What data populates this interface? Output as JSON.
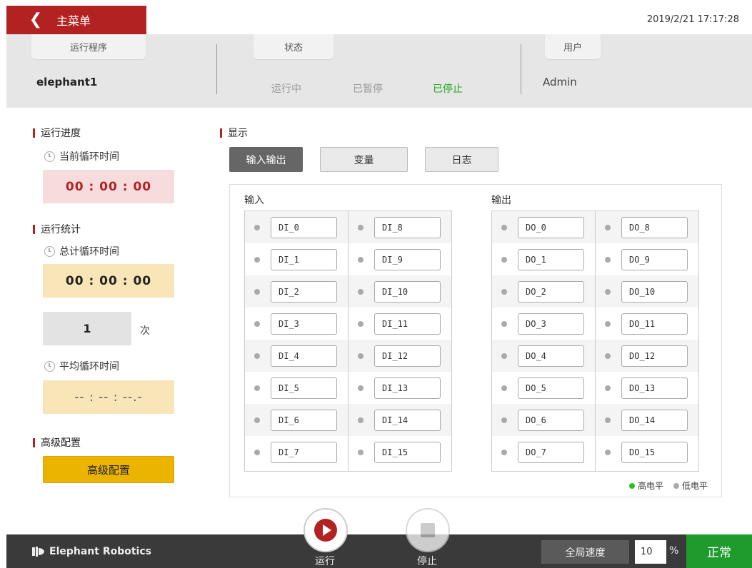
{
  "header_bar": {
    "back_label": "主菜单",
    "datetime": "2019/2/21 17:17:28"
  },
  "status_header": {
    "program_tab": "运行程序",
    "program_name": "elephant1",
    "state_tab": "状态",
    "states": [
      {
        "label": "运行中",
        "active": false
      },
      {
        "label": "已暂停",
        "active": false
      },
      {
        "label": "已停止",
        "active": true
      }
    ],
    "user_tab": "用户",
    "user_name": "Admin"
  },
  "left_panel": {
    "progress_title": "运行进度",
    "current_cycle_label": "当前循环时间",
    "current_cycle_time": "00 : 00 : 00",
    "stats_title": "运行统计",
    "total_cycle_label": "总计循环时间",
    "total_cycle_time": "00 : 00 : 00",
    "cycle_count": "1",
    "cycle_count_unit": "次",
    "avg_cycle_label": "平均循环时间",
    "avg_cycle_time": "-- : -- : --.-",
    "advanced_title": "高级配置",
    "advanced_button": "高级配置"
  },
  "display": {
    "title": "显示",
    "tabs": [
      {
        "label": "输入输出",
        "active": true
      },
      {
        "label": "变量",
        "active": false
      },
      {
        "label": "日志",
        "active": false
      }
    ],
    "input_title": "输入",
    "output_title": "输出",
    "inputs_left": [
      "DI_0",
      "DI_1",
      "DI_2",
      "DI_3",
      "DI_4",
      "DI_5",
      "DI_6",
      "DI_7"
    ],
    "inputs_right": [
      "DI_8",
      "DI_9",
      "DI_10",
      "DI_11",
      "DI_12",
      "DI_13",
      "DI_14",
      "DI_15"
    ],
    "outputs_left": [
      "DO_0",
      "DO_1",
      "DO_2",
      "DO_3",
      "DO_4",
      "DO_5",
      "DO_6",
      "DO_7"
    ],
    "outputs_right": [
      "DO_8",
      "DO_9",
      "DO_10",
      "DO_11",
      "DO_12",
      "DO_13",
      "DO_14",
      "DO_15"
    ],
    "legend_high": "高电平",
    "legend_low": "低电平",
    "colors": {
      "high": "#22c422",
      "low": "#aaaaaa"
    }
  },
  "bottom_bar": {
    "brand": "Elephant Robotics",
    "run_label": "运行",
    "stop_label": "停止",
    "speed_label": "全局速度",
    "speed_value": "10",
    "speed_unit": "%",
    "status": "正常"
  },
  "colors": {
    "accent_red": "#b22222",
    "ok_green": "#1f9b2d",
    "warn_yellow": "#ebb400"
  }
}
